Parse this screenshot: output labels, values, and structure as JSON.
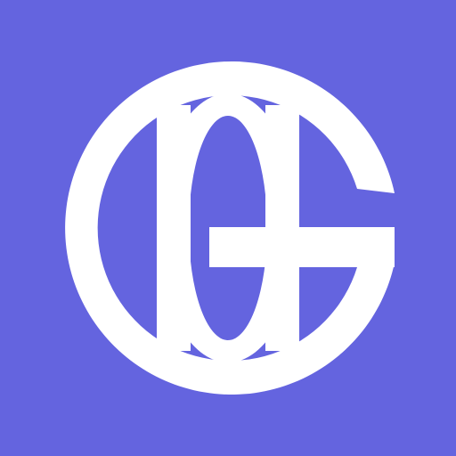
{
  "app_icon": {
    "icon": "globe-g-logo-icon",
    "colors": {
      "background": "#6464DF",
      "mark": "#FFFFFF"
    }
  }
}
